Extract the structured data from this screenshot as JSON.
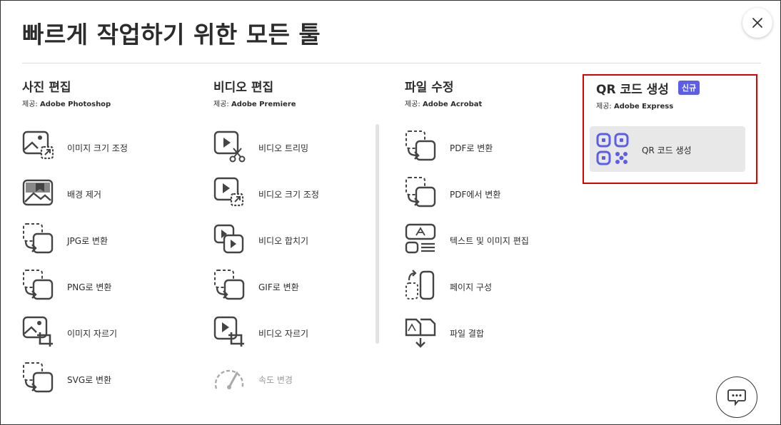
{
  "title": "빠르게 작업하기 위한 모든 툴",
  "columns": [
    {
      "heading": "사진 편집",
      "provider_prefix": "제공: ",
      "provider": "Adobe Photoshop",
      "items": [
        {
          "label": "이미지 크기 조정",
          "icon": "image-resize-icon"
        },
        {
          "label": "배경 제거",
          "icon": "remove-background-icon"
        },
        {
          "label": "JPG로 변환",
          "icon": "convert-icon"
        },
        {
          "label": "PNG로 변환",
          "icon": "convert-icon"
        },
        {
          "label": "이미지 자르기",
          "icon": "image-crop-icon"
        },
        {
          "label": "SVG로 변환",
          "icon": "convert-icon"
        }
      ]
    },
    {
      "heading": "비디오 편집",
      "provider_prefix": "제공: ",
      "provider": "Adobe Premiere",
      "items": [
        {
          "label": "비디오 트리밍",
          "icon": "video-trim-icon"
        },
        {
          "label": "비디오 크기 조정",
          "icon": "video-resize-icon"
        },
        {
          "label": "비디오 합치기",
          "icon": "video-merge-icon"
        },
        {
          "label": "GIF로 변환",
          "icon": "convert-icon"
        },
        {
          "label": "비디오 자르기",
          "icon": "video-crop-icon"
        },
        {
          "label": "속도 변경",
          "icon": "speed-icon"
        }
      ]
    },
    {
      "heading": "파일 수정",
      "provider_prefix": "제공: ",
      "provider": "Adobe Acrobat",
      "items": [
        {
          "label": "PDF로 변환",
          "icon": "convert-icon"
        },
        {
          "label": "PDF에서 변환",
          "icon": "convert-icon"
        },
        {
          "label": "텍스트 및 이미지 편집",
          "icon": "pdf-edit-icon"
        },
        {
          "label": "페이지 구성",
          "icon": "organize-pages-icon"
        },
        {
          "label": "파일 결합",
          "icon": "combine-files-icon"
        }
      ]
    },
    {
      "heading": "QR 코드 생성",
      "badge": "신규",
      "provider_prefix": "제공: ",
      "provider": "Adobe Express",
      "items": [
        {
          "label": "QR 코드 생성",
          "icon": "qr-code-icon"
        }
      ]
    }
  ],
  "colors": {
    "accent_badge": "#5d5ee8",
    "qr_icon": "#5d5ee8",
    "highlight": "#e00000"
  }
}
